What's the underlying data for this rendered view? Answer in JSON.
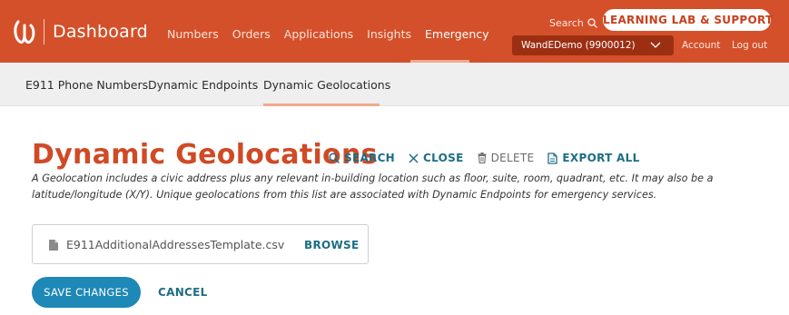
{
  "header": {
    "brand_title": "Dashboard",
    "nav": [
      "Numbers",
      "Orders",
      "Applications",
      "Insights",
      "Emergency"
    ],
    "active_nav": "Emergency",
    "search_label": "Search",
    "learning_button": "LEARNING LAB & SUPPORT",
    "account_select": "WandEDemo (9900012)",
    "account_link": "Account",
    "logout_link": "Log out"
  },
  "subnav": {
    "tabs": [
      "E911 Phone Numbers",
      "Dynamic Endpoints",
      "Dynamic Geolocations"
    ],
    "active_tab": "Dynamic Geolocations"
  },
  "main": {
    "title": "Dynamic Geolocations",
    "actions": {
      "search": "SEARCH",
      "close": "CLOSE",
      "delete": "DELETE",
      "export": "EXPORT ALL"
    },
    "description": "A Geolocation includes a civic address plus any relevant in-building location such as floor, suite, room, quadrant, etc. It may also be a latitude/longitude (X/Y). Unique geolocations from this list are associated with Dynamic Endpoints for emergency services.",
    "file": {
      "name": "E911AdditionalAddressesTemplate.csv",
      "browse": "BROWSE"
    },
    "save_button": "SAVE CHANGES",
    "cancel_button": "CANCEL"
  },
  "colors": {
    "brand": "#d4502a",
    "title": "#cf4a25",
    "link": "#1d6e86",
    "primary_button": "#1e88b6",
    "account_select_bg": "#9c2f12"
  },
  "icons": [
    "logo-icon",
    "search-icon",
    "chevron-down-icon",
    "close-icon",
    "trash-icon",
    "export-file-icon",
    "file-icon"
  ]
}
